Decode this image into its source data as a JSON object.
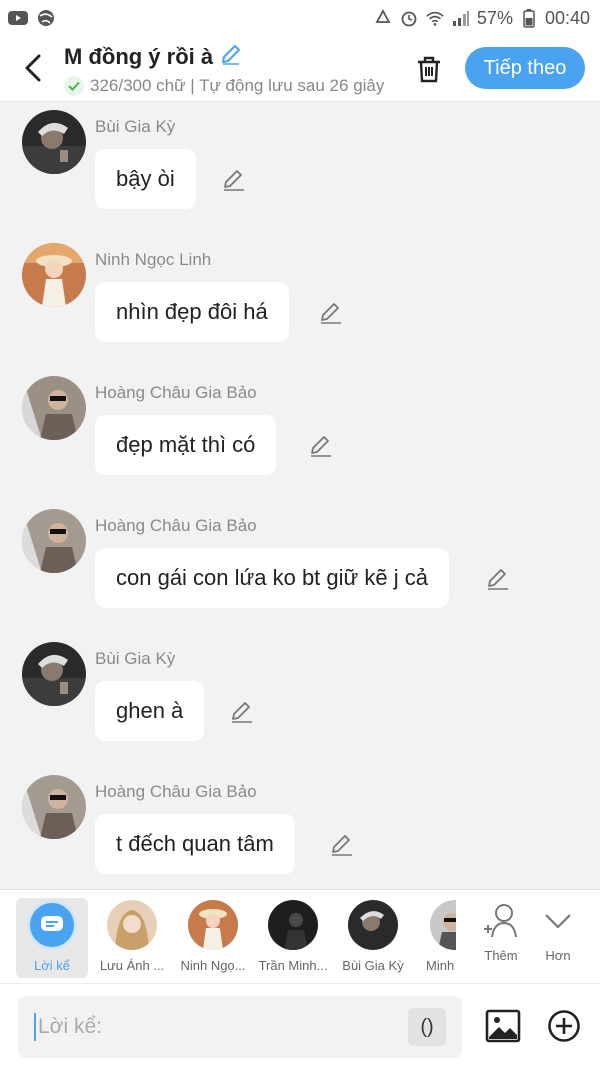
{
  "status_bar": {
    "battery": "57%",
    "time": "00:40"
  },
  "header": {
    "title": "M đồng ý rồi à",
    "subtitle": "326/300 chữ | Tự động lưu sau 26 giây",
    "next_label": "Tiếp theo"
  },
  "messages": [
    {
      "name": "Bùi Gia Kỳ",
      "text": "bậy òi"
    },
    {
      "name": "Ninh Ngọc Linh",
      "text": "nhìn đẹp đôi há"
    },
    {
      "name": "Hoàng Châu Gia Bảo",
      "text": "đẹp mặt thì có"
    },
    {
      "name": "Hoàng Châu Gia Bảo",
      "text": "con gái con lứa ko bt giữ kẽ j cả"
    },
    {
      "name": "Bùi Gia Kỳ",
      "text": "ghen à"
    },
    {
      "name": "Hoàng Châu Gia Bảo",
      "text": "t đếch quan tâm"
    }
  ],
  "characters": [
    {
      "label": "Lời kể"
    },
    {
      "label": "Lưu Ánh ..."
    },
    {
      "label": "Ninh Ngọ..."
    },
    {
      "label": "Trần Minh..."
    },
    {
      "label": "Bùi Gia Kỳ"
    },
    {
      "label": "Minh"
    }
  ],
  "char_actions": {
    "add_label": "Thêm",
    "more_label": "Hơn"
  },
  "input": {
    "placeholder": "Lời kể:",
    "paren": "()"
  },
  "colors": {
    "accent": "#4aa3f0",
    "background": "#f2f2f2",
    "bubble": "#ffffff"
  },
  "icons": [
    "youtube-icon",
    "browser-icon",
    "recycle-icon",
    "alarm-icon",
    "wifi-icon",
    "signal-icon",
    "battery-icon",
    "back-icon",
    "pencil-icon",
    "check-icon",
    "trash-icon",
    "edit-icon",
    "narrator-icon",
    "add-person-icon",
    "chevron-down-icon",
    "image-icon",
    "plus-circle-icon"
  ]
}
